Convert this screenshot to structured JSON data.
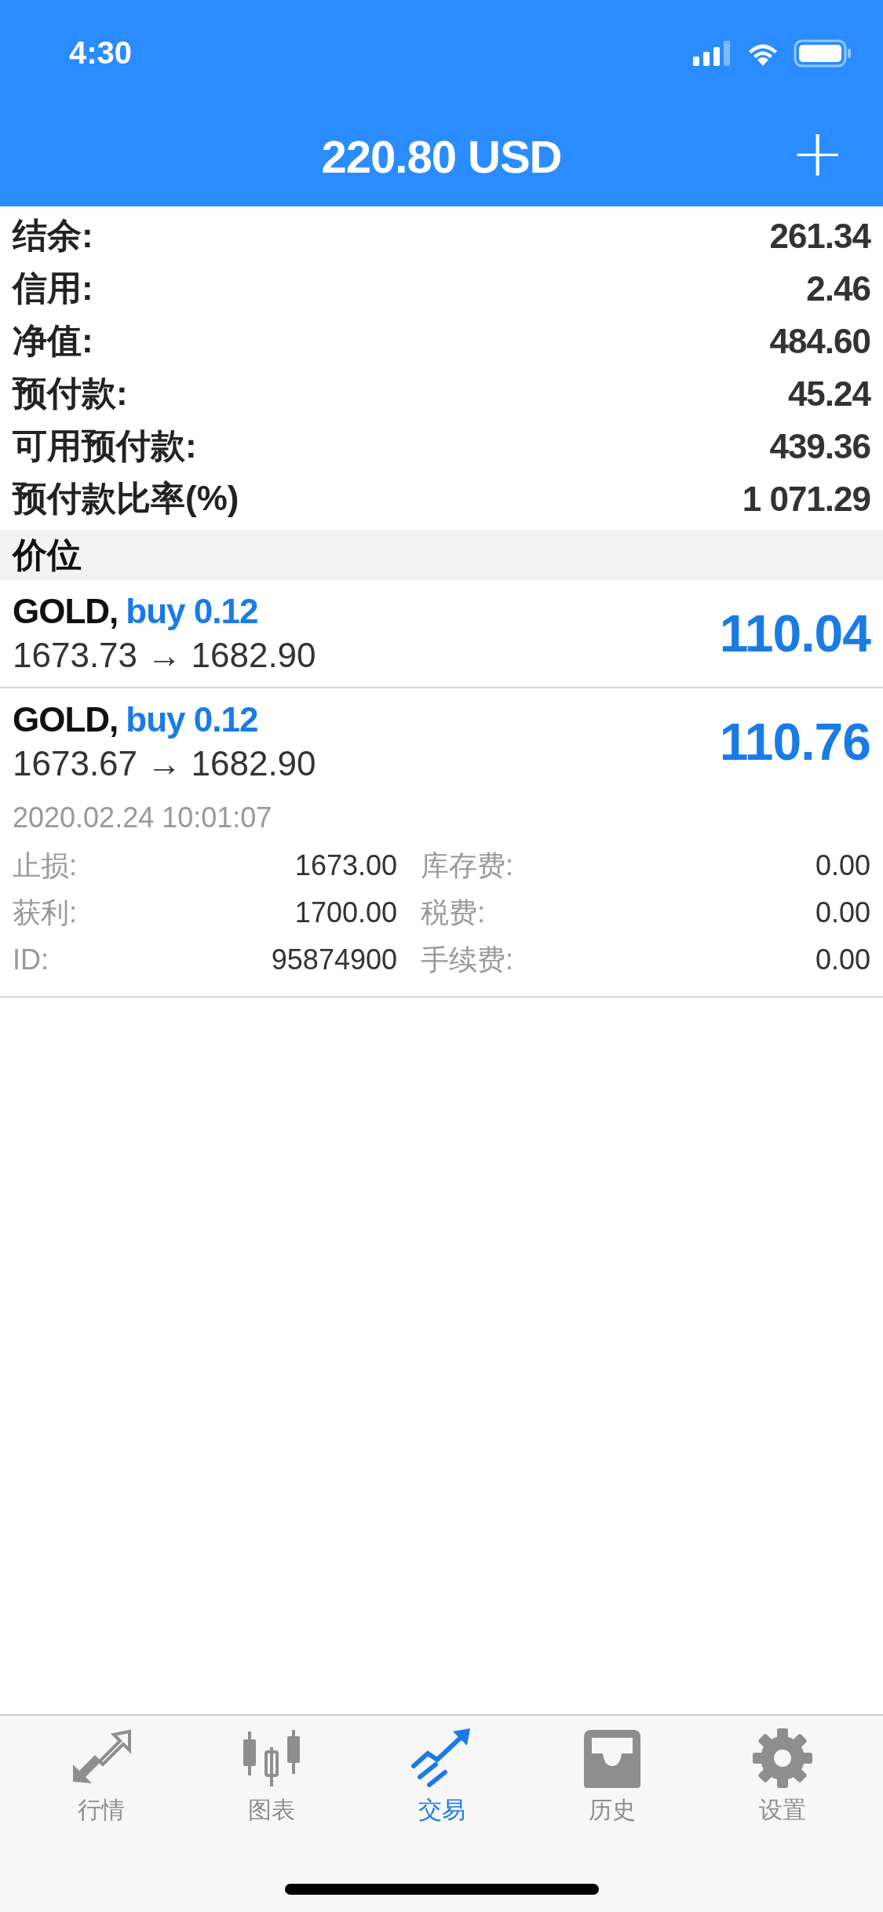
{
  "status_bar": {
    "time": "4:30"
  },
  "header": {
    "title": "220.80 USD",
    "add_button": "+"
  },
  "summary": [
    {
      "label": "结余:",
      "value": "261.34"
    },
    {
      "label": "信用:",
      "value": "2.46"
    },
    {
      "label": "净值:",
      "value": "484.60"
    },
    {
      "label": "预付款:",
      "value": "45.24"
    },
    {
      "label": "可用预付款:",
      "value": "439.36"
    },
    {
      "label": "预付款比率(%)",
      "value": "1 071.29"
    }
  ],
  "section": {
    "title": "价位"
  },
  "positions": [
    {
      "symbol": "GOLD,",
      "side": "buy 0.12",
      "prices": "1673.73 → 1682.90",
      "profit": "110.04",
      "expanded": false
    },
    {
      "symbol": "GOLD,",
      "side": "buy 0.12",
      "prices": "1673.67 → 1682.90",
      "profit": "110.76",
      "expanded": true,
      "time": "2020.02.24 10:01:07",
      "details": [
        [
          {
            "label": "止损:",
            "value": "1673.00"
          },
          {
            "label": "库存费:",
            "value": "0.00"
          }
        ],
        [
          {
            "label": "获利:",
            "value": "1700.00"
          },
          {
            "label": "税费:",
            "value": "0.00"
          }
        ],
        [
          {
            "label": "ID:",
            "value": "95874900"
          },
          {
            "label": "手续费:",
            "value": "0.00"
          }
        ]
      ]
    }
  ],
  "tabs": [
    {
      "label": "行情",
      "kind": "quotes",
      "selected": false
    },
    {
      "label": "图表",
      "kind": "chart",
      "selected": false
    },
    {
      "label": "交易",
      "kind": "trade",
      "selected": true
    },
    {
      "label": "历史",
      "kind": "history",
      "selected": false
    },
    {
      "label": "设置",
      "kind": "settings",
      "selected": false
    }
  ]
}
